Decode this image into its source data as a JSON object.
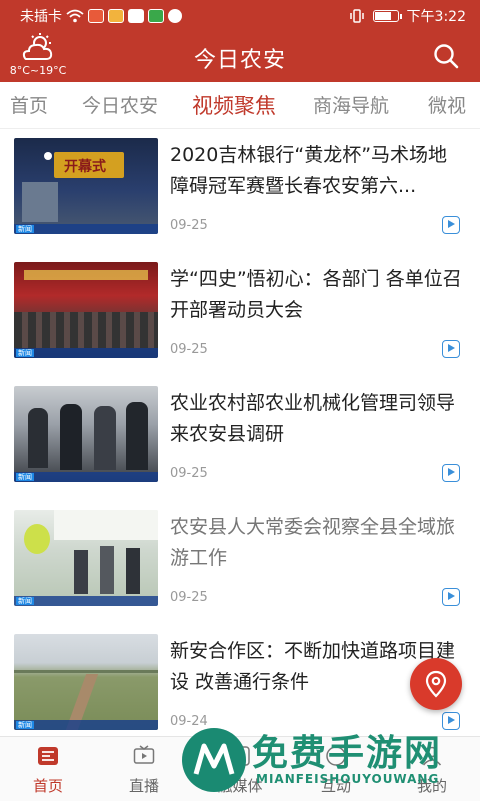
{
  "status_bar": {
    "carrier": "未插卡",
    "time": "下午3:22",
    "battery_level": 0.8
  },
  "header": {
    "temperature": "8°C~19°C",
    "title": "今日农安",
    "search_icon": "search-icon",
    "weather_icon": "cloudy-sun-icon"
  },
  "tabs": [
    {
      "label": "首页"
    },
    {
      "label": "今日农安"
    },
    {
      "label": "视频聚焦"
    },
    {
      "label": "商海导航"
    },
    {
      "label": "微视"
    }
  ],
  "active_tab": 2,
  "news": [
    {
      "title": "2020吉林银行“黄龙杯”马术场地障碍冠军赛暨长春农安第六...",
      "date": "09-25",
      "thumb_text": "开幕式"
    },
    {
      "title": "学“四史”悟初心：各部门 各单位召开部署动员大会",
      "date": "09-25"
    },
    {
      "title": "农业农村部农业机械化管理司领导来农安县调研",
      "date": "09-25"
    },
    {
      "title": "农安县人大常委会视察全县全域旅游工作",
      "date": "09-25"
    },
    {
      "title": "新安合作区：不断加快道路项目建设 改善通行条件",
      "date": "09-24"
    }
  ],
  "thumb_tag": "新闻",
  "bottom_nav": [
    {
      "label": "首页",
      "icon": "home-news-icon"
    },
    {
      "label": "直播",
      "icon": "live-tv-icon"
    },
    {
      "label": "融媒体",
      "icon": "media-icon"
    },
    {
      "label": "互动",
      "icon": "interaction-icon"
    },
    {
      "label": "我的",
      "icon": "profile-icon"
    }
  ],
  "watermark": {
    "title": "免费手游网",
    "subtitle": "MIANFEISHOUYOUWANG"
  },
  "colors": {
    "brand_red": "#c0392b",
    "link_blue": "#3a8fd9",
    "watermark_green": "#1f8f73"
  }
}
